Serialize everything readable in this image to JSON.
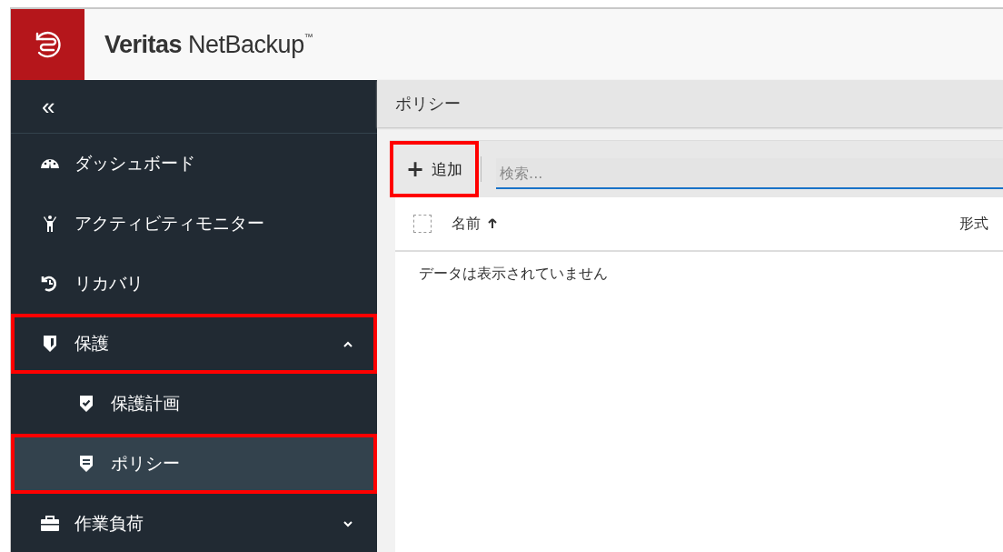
{
  "header": {
    "brand_bold": "Veritas",
    "brand_light": "NetBackup",
    "trademark": "™"
  },
  "sidebar": {
    "collapse": "«",
    "items": [
      {
        "kind": "item",
        "label": "ダッシュボード",
        "selected": false,
        "highlighted": false
      },
      {
        "kind": "item",
        "label": "アクティビティモニター",
        "selected": false,
        "highlighted": false
      },
      {
        "kind": "item",
        "label": "リカバリ",
        "selected": false,
        "highlighted": false
      },
      {
        "kind": "group",
        "label": "保護",
        "selected": false,
        "highlighted": true,
        "expanded": true,
        "children": [
          {
            "label": "保護計画",
            "selected": false,
            "highlighted": false
          },
          {
            "label": "ポリシー",
            "selected": true,
            "highlighted": true
          }
        ]
      },
      {
        "kind": "group",
        "label": "作業負荷",
        "selected": false,
        "highlighted": false,
        "expanded": false
      }
    ]
  },
  "breadcrumb": "ポリシー",
  "toolbar": {
    "add_button": {
      "icon": "+",
      "label": "追加",
      "highlighted": true
    },
    "search": {
      "placeholder": "検索..."
    }
  },
  "table": {
    "select_all_checked": false,
    "columns": [
      {
        "label": "名前",
        "sorted": true
      },
      {
        "label": "形式",
        "sorted": false
      }
    ],
    "empty_message": "データは表示されていません"
  }
}
